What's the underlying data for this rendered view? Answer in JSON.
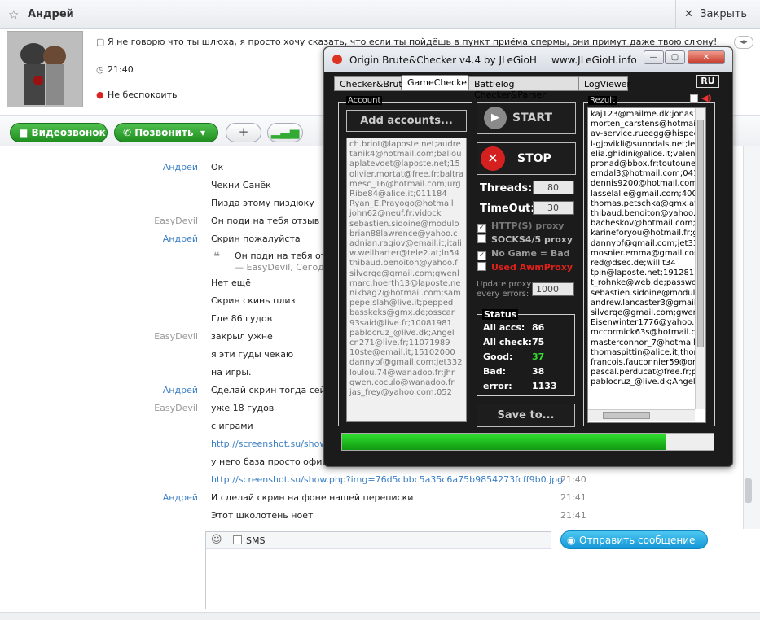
{
  "header": {
    "contact_name": "Андрей",
    "close_label": "Закрыть"
  },
  "profile": {
    "status_message": "Я не говорю что ты шлюха, я просто хочу сказать, что если ты пойдёшь в пункт приёма спермы, они примут даже твою слюну!",
    "local_time": "21:40",
    "presence": "Не беспокоить"
  },
  "actions": {
    "video_call": "Видеозвонок",
    "call": "Позвонить",
    "add": "+"
  },
  "messages": [
    {
      "author": "Андрей",
      "text": "Ок",
      "time": "",
      "kind": "a"
    },
    {
      "author": "",
      "text": "Чекни Санёк",
      "time": "",
      "kind": "a"
    },
    {
      "author": "",
      "text": "Пизда этому пиздюку",
      "time": "",
      "kind": "a"
    },
    {
      "author": "EasyDevil",
      "text": "Он поди на тебя отзыв напи",
      "time": "",
      "kind": "e"
    },
    {
      "author": "Андрей",
      "text": "Скрин пожалуйста",
      "time": "",
      "kind": "a"
    },
    {
      "author": "",
      "text": "",
      "time": "",
      "kind": "q"
    },
    {
      "author": "",
      "text": "Нет ещё",
      "time": "",
      "kind": "a"
    },
    {
      "author": "",
      "text": "Скрин скинь плиз",
      "time": "",
      "kind": "a"
    },
    {
      "author": "",
      "text": "Где 86 гудов",
      "time": "",
      "kind": "a"
    },
    {
      "author": "EasyDevil",
      "text": "закрыл ужне",
      "time": "",
      "kind": "e"
    },
    {
      "author": "",
      "text": "я эти гуды чекаю",
      "time": "",
      "kind": "e"
    },
    {
      "author": "",
      "text": "на игры.",
      "time": "",
      "kind": "e"
    },
    {
      "author": "Андрей",
      "text": "Сделай скрин тогда сейчас",
      "time": "",
      "kind": "a"
    },
    {
      "author": "EasyDevil",
      "text": "уже 18 гудов",
      "time": "",
      "kind": "e"
    },
    {
      "author": "",
      "text": "с играми",
      "time": "",
      "kind": "e"
    },
    {
      "author": "",
      "text": "http://screenshot.su/show.p",
      "time": "",
      "kind": "link"
    },
    {
      "author": "",
      "text": "у него база просто офиген",
      "time": "",
      "kind": "e"
    },
    {
      "author": "",
      "text": "http://screenshot.su/show.php?img=76d5cbbc5a35c6a75b9854273fcff9b0.jpg",
      "time": "21:40",
      "kind": "link"
    },
    {
      "author": "Андрей",
      "text": "И сделай скрин на фоне нашей переписки",
      "time": "21:41",
      "kind": "a"
    },
    {
      "author": "",
      "text": "Этот школотень ноет",
      "time": "21:41",
      "kind": "a"
    }
  ],
  "quote": {
    "text": "Он поди на тебя отзыв",
    "meta": "— EasyDevil, Сегодня"
  },
  "compose": {
    "sms_label": "SMS",
    "send_label": "Отправить сообщение"
  },
  "brute": {
    "title": "Origin Brute&Checker  v4.4  by JLeGioH",
    "site": "www.JLeGioH.info",
    "tabs": [
      "Checker&Brute",
      "GameChecker",
      "Battlelog Checker&Parser",
      "LogViewer"
    ],
    "lang": "RU",
    "account_label": "Account",
    "add_accounts": "Add accounts...",
    "accounts": [
      "ch.briot@laposte.net;audre",
      "tanik4@hotmail.com;ballou",
      "aplatevoet@laposte.net;15",
      "olivier.mortat@free.fr;baltra",
      "mesc_16@hotmail.com;urg",
      "Ribe84@alice.it;011184",
      "Ryan_E.Prayogo@hotmail",
      "john62@neuf.fr;vidock",
      "sebastien.sidoine@modulo",
      "brian88lawrence@yahoo.c",
      "adnian.ragiov@email.it;itali",
      "w.weilharter@tele2.at;ln54",
      "thibaud.benoiton@yahoo.f",
      "silverqe@gmail.com;gwenl",
      "marc.hoerth13@laposte.ne",
      "nikbag2@hotmail.com;sam",
      "pepe.slah@live.it;pepped",
      "basskeks@gmx.de;osscar",
      "93said@live.fr;10081981",
      "pablocruz_@live.dk;Angel",
      "cn271@live.fr;11071989",
      "10ste@email.it;15102000",
      "dannypf@gmail.com;jet332",
      "loulou.74@wanadoo.fr;jhr",
      "gwen.coculo@wanadoo.fr",
      "jas_frey@yahoo.com;052"
    ],
    "start": "START",
    "stop": "STOP",
    "threads_label": "Threads:",
    "threads": "80",
    "timeout_label": "TimeOut:",
    "timeout": "30",
    "opt_http": "HTTP(S) proxy",
    "opt_socks": "SOCKS4/5 proxy",
    "opt_nogame": "No Game = Bad",
    "opt_awm": "Used AwmProxy",
    "update_proxy": "Update proxy\nevery errors:",
    "update_value": "1000",
    "status_label": "Status",
    "stats": [
      {
        "k": "All accs:",
        "v": "86",
        "c": "#ffffff"
      },
      {
        "k": "All check:",
        "v": "75",
        "c": "#ffffff"
      },
      {
        "k": "Good:",
        "v": "37",
        "c": "#35d935"
      },
      {
        "k": "Bad:",
        "v": "38",
        "c": "#ffffff"
      },
      {
        "k": "error:",
        "v": "1133",
        "c": "#ffffff"
      }
    ],
    "save": "Save to...",
    "rezult_label": "Rezult",
    "results": [
      "kaj123@mailme.dk;jonas1",
      "morten_carstens@hotmail.",
      "av-service.rueegg@hispee",
      "l-gjovikli@sunndals.net;lee",
      "elia.ghidini@alice.it;valenti",
      "pronad@bbox.fr;toutoune",
      "emdal3@hotmail.com;0412",
      "dennis9200@hotmail.com;",
      "lasselalle@gmail.com;4004",
      "thomas.petschka@gmx.at",
      "thibaud.benoiton@yahoo.f",
      "bacheskov@hotmail.com;r",
      "karineforyou@hotmail.fr;gu",
      "dannypf@gmail.com;jet332",
      "mosnier.emma@gmail.com",
      "red@dsec.de;willit34",
      "tpin@laposte.net;191281",
      "t_rohnke@web.de;passwo",
      "sebastien.sidoine@modulo",
      "andrew.lancaster3@gmail.",
      "silverqe@gmail.com;gwenl",
      "Eisenwinter1776@yahoo.c",
      "mccormick63s@hotmail.co",
      "masterconnor_7@hotmail.c",
      "thomaspittin@alice.it;thom",
      "francois.fauconnier59@ora",
      "pascal.perducat@free.fr;pe",
      "pablocruz_@live.dk;Angel"
    ],
    "progress": 0.87
  }
}
